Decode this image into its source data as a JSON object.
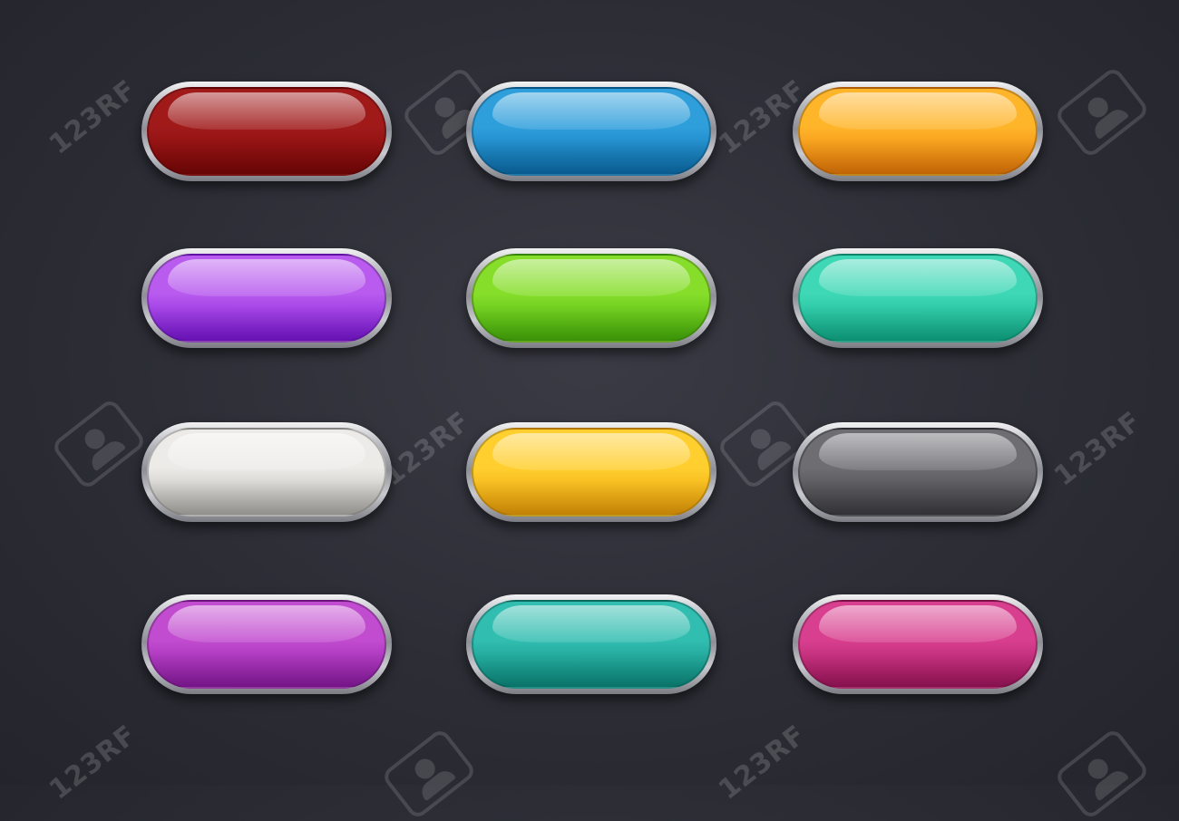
{
  "watermark": {
    "text": "123RF"
  },
  "buttons": [
    {
      "color": "#a01a1a",
      "color_dark": "#7e0606",
      "row": 1,
      "col": 1
    },
    {
      "color": "#2f9fdc",
      "color_dark": "#0b6fae",
      "row": 1,
      "col": 2
    },
    {
      "color": "#ffb52a",
      "color_dark": "#ea7a08",
      "row": 1,
      "col": 3
    },
    {
      "color": "#b85bee",
      "color_dark": "#7c15d8",
      "row": 2,
      "col": 1
    },
    {
      "color": "#86de2a",
      "color_dark": "#47b10a",
      "row": 2,
      "col": 2
    },
    {
      "color": "#3fd8b6",
      "color_dark": "#0fae8a",
      "row": 2,
      "col": 3
    },
    {
      "color": "#ecebe8",
      "color_dark": "#b1afaa",
      "row": 3,
      "col": 1
    },
    {
      "color": "#ffcf2f",
      "color_dark": "#eb9e07",
      "row": 3,
      "col": 2
    },
    {
      "color": "#6d6d72",
      "color_dark": "#3d3d42",
      "row": 3,
      "col": 3
    },
    {
      "color": "#c24cd0",
      "color_dark": "#8d1aa4",
      "row": 4,
      "col": 1
    },
    {
      "color": "#31bdb0",
      "color_dark": "#0c8c7f",
      "row": 4,
      "col": 2
    },
    {
      "color": "#d8408f",
      "color_dark": "#a3155f",
      "row": 4,
      "col": 3
    }
  ]
}
